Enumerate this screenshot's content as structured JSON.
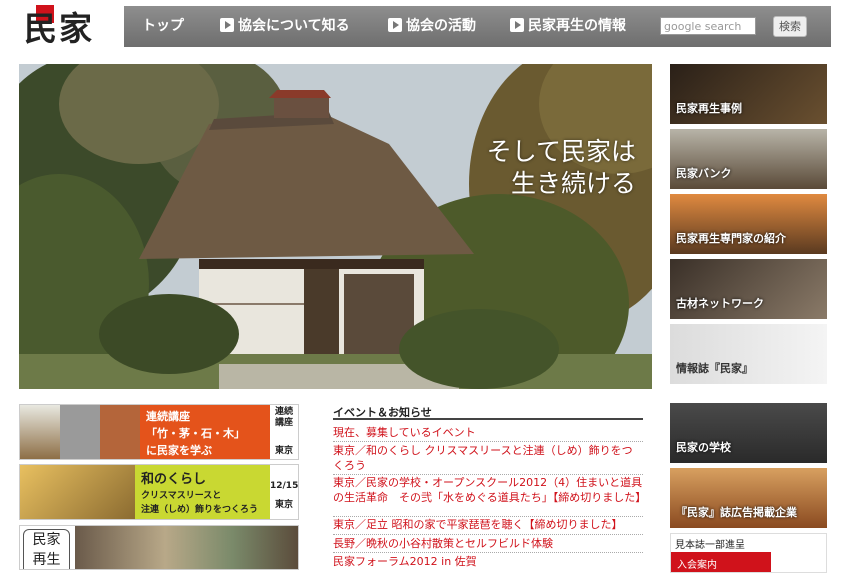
{
  "logo": {
    "text": "民家"
  },
  "nav": {
    "items": [
      {
        "label": "トップ",
        "arrow": false
      },
      {
        "label": "協会について知る",
        "arrow": true
      },
      {
        "label": "協会の活動",
        "arrow": true
      },
      {
        "label": "民家再生の情報",
        "arrow": true
      }
    ],
    "search_placeholder": "google search",
    "search_button": "検索"
  },
  "hero": {
    "caption_line1": "そして民家は",
    "caption_line2": "生き続ける"
  },
  "sidebar": {
    "items": [
      {
        "label": "民家再生事例"
      },
      {
        "label": "民家バンク"
      },
      {
        "label": "民家再生専門家の紹介"
      },
      {
        "label": "古材ネットワーク"
      },
      {
        "label": "情報誌『民家』"
      },
      {
        "label": "民家の学校"
      },
      {
        "label": "『民家』誌広告掲載企業"
      },
      {
        "label": "見本誌一部進呈",
        "label2": "入会案内"
      }
    ]
  },
  "lectures": {
    "lecture1": {
      "title": "連続講座",
      "line2": "「竹・茅・石・木」",
      "line3": "に民家を学ぶ",
      "side1": "連続",
      "side2": "講座",
      "place": "東京"
    },
    "lecture2": {
      "title": "和のくらし",
      "line2": "クリスマスリースと",
      "line3": "注連（しめ）飾りをつくろう",
      "date": "12/15",
      "place": "東京"
    },
    "lecture3": {
      "t1": "民家",
      "t2": "再生"
    }
  },
  "events": {
    "title": "イベント＆お知らせ",
    "items": [
      "現在、募集しているイベント",
      "東京／和のくらし クリスマスリースと注連（しめ）飾りをつくろう",
      "東京／民家の学校・オープンスクール2012（4）住まいと道具の生活革命　その弐「水をめぐる道具たち」【締め切りました】",
      "東京／足立 昭和の家で平家琵琶を聴く【締め切りました】",
      "長野／晩秋の小谷村散策とセルフビルド体験",
      "民家フォーラム2012 in 佐賀"
    ]
  },
  "colors": {
    "accent": "#d0121b",
    "nav_bg": "#7d7d7d",
    "lecture_orange": "#e4531b",
    "lecture_green": "#c9d832"
  }
}
